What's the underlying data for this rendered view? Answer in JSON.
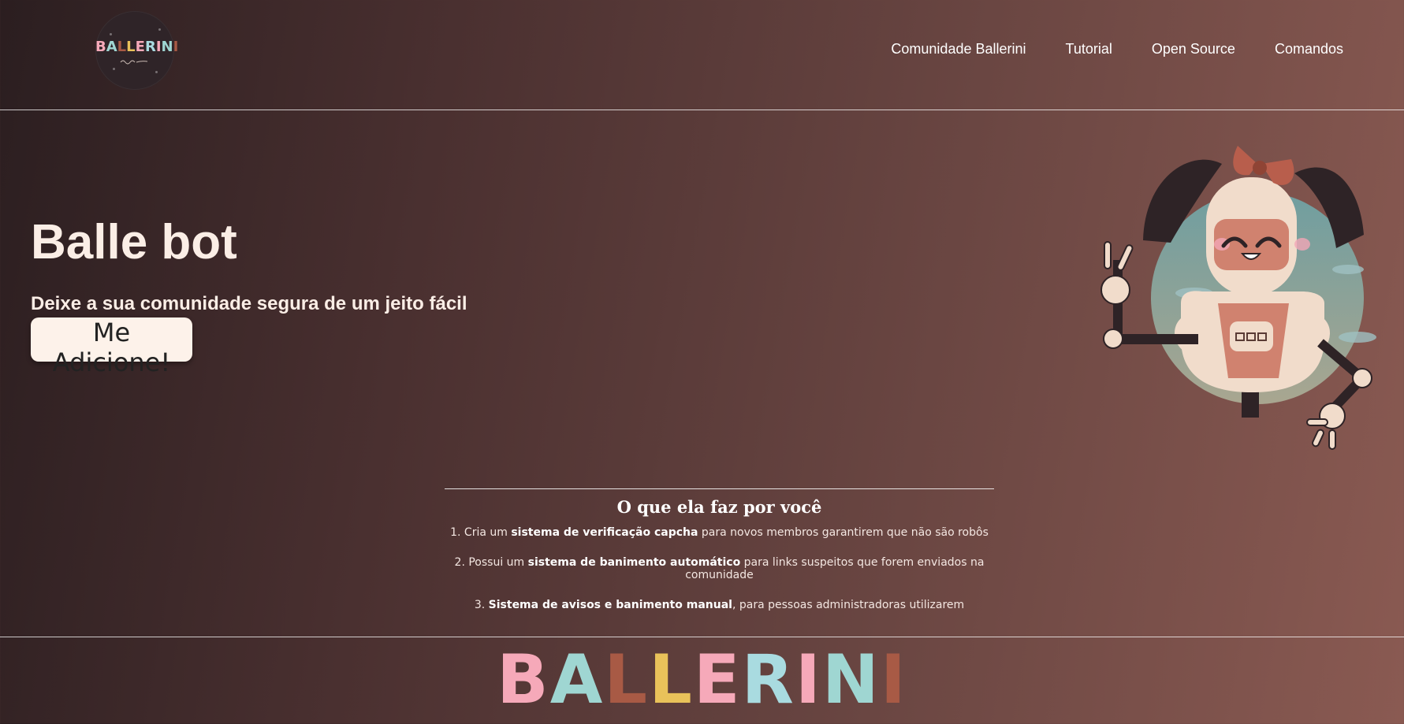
{
  "brand": {
    "logo_text": "BALLERINI",
    "letter_colors": [
      "#f6a9b9",
      "#9fd6d2",
      "#a85a45",
      "#e9c25a",
      "#f6a9b9",
      "#a9dbe0",
      "#f6a9b9",
      "#9fd6d2",
      "#a85a45"
    ]
  },
  "nav": {
    "items": [
      {
        "label": "Comunidade Ballerini"
      },
      {
        "label": "Tutorial"
      },
      {
        "label": "Open Source"
      },
      {
        "label": "Comandos"
      }
    ]
  },
  "hero": {
    "title": "Balle bot",
    "subtitle": "Deixe a sua comunidade segura de um jeito fácil",
    "cta_label": "Me Adicione!"
  },
  "features": {
    "heading": "O que ela faz por você",
    "items": [
      {
        "prefix": "1. Cria um ",
        "bold": "sistema de verificação capcha",
        "suffix": " para novos membros garantirem que não são robôs"
      },
      {
        "prefix": "2. Possui um ",
        "bold": "sistema de banimento automático",
        "suffix": " para links suspeitos que forem enviados na comunidade"
      },
      {
        "prefix": "3. ",
        "bold": "Sistema de avisos e banimento manual",
        "suffix": ", para pessoas administradoras utilizarem"
      }
    ]
  },
  "footer": {
    "logo_text": "BALLERINI"
  }
}
